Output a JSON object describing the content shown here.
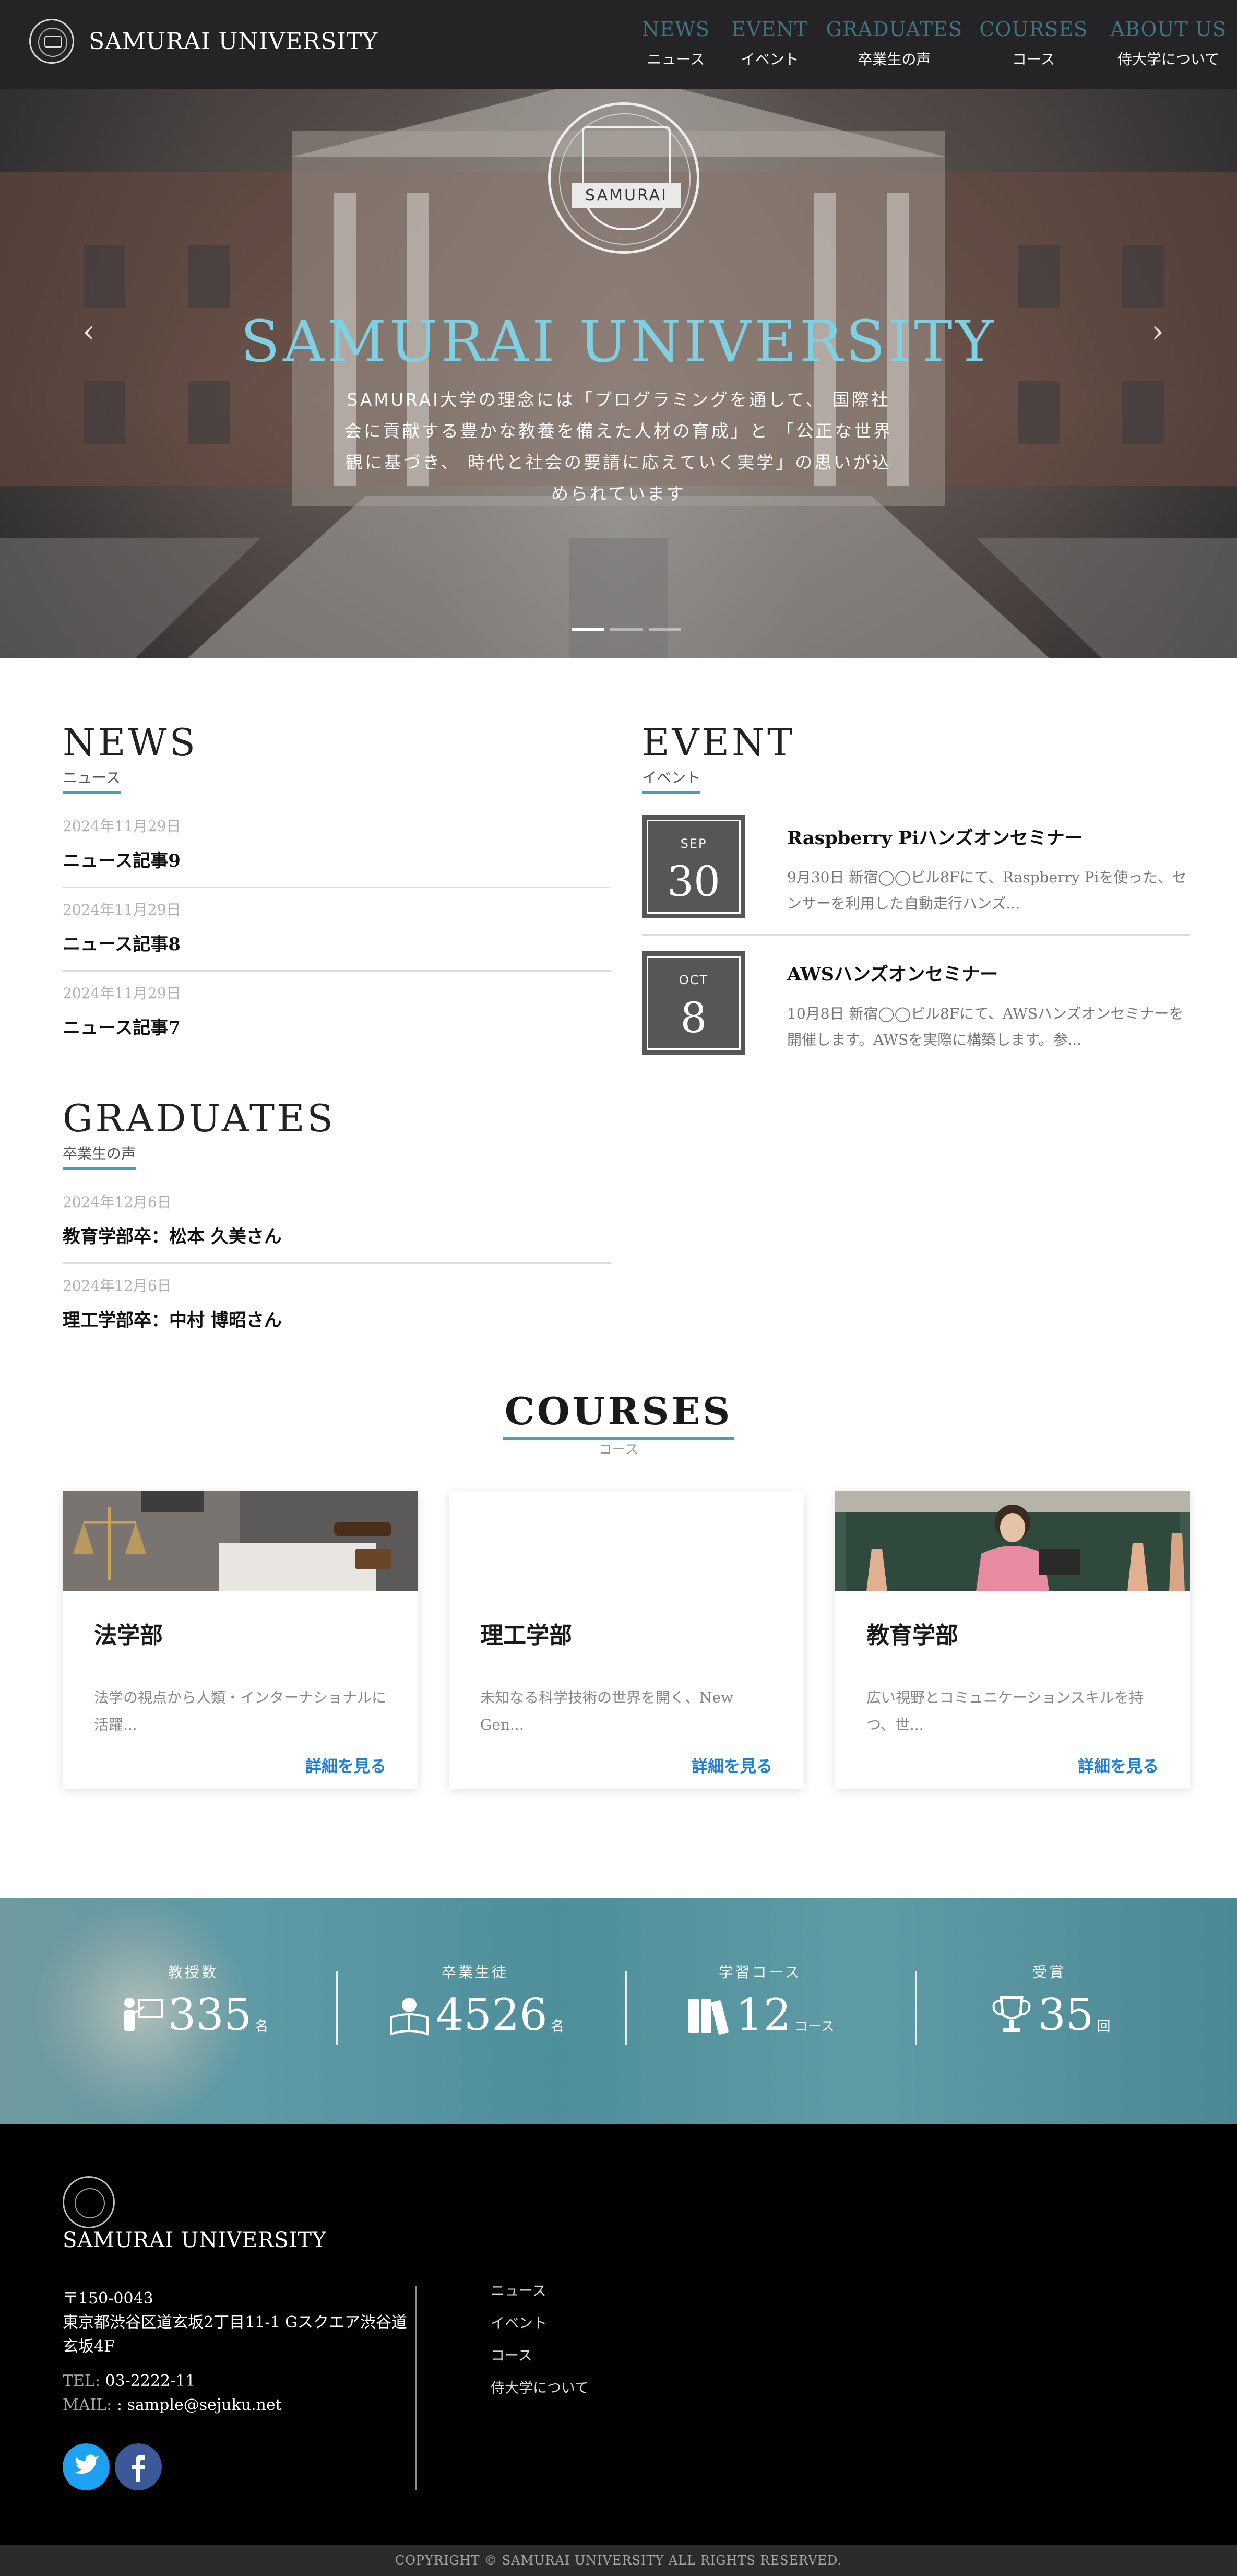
{
  "header": {
    "brand": "SAMURAI UNIVERSITY",
    "nav": [
      {
        "en": "NEWS",
        "jp": "ニュース"
      },
      {
        "en": "EVENT",
        "jp": "イベント"
      },
      {
        "en": "GRADUATES",
        "jp": "卒業生の声"
      },
      {
        "en": "COURSES",
        "jp": "コース"
      },
      {
        "en": "ABOUT US",
        "jp": "侍大学について"
      }
    ]
  },
  "hero": {
    "emblem_text": "SAMURAI",
    "title": "SAMURAI UNIVERSITY",
    "text": "SAMURAI大学の理念には「プログラミングを通して、 国際社会に貢献する豊かな教養を備えた人材の育成」と 「公正な世界観に基づき、 時代と社会の要請に応えていく実学」の思いが込められています",
    "prev_icon": "chevron-left-icon",
    "next_icon": "chevron-right-icon"
  },
  "news": {
    "title": "NEWS",
    "subtitle": "ニュース",
    "items": [
      {
        "date": "2024年11月29日",
        "title": "ニュース記事9"
      },
      {
        "date": "2024年11月29日",
        "title": "ニュース記事8"
      },
      {
        "date": "2024年11月29日",
        "title": "ニュース記事7"
      }
    ]
  },
  "event": {
    "title": "EVENT",
    "subtitle": "イベント",
    "items": [
      {
        "month": "SEP",
        "day": "30",
        "title": "Raspberry Piハンズオンセミナー",
        "desc": "9月30日 新宿◯◯ビル8Fにて、Raspberry Piを使った、センサーを利用した自動走行ハンズ..."
      },
      {
        "month": "OCT",
        "day": "8",
        "title": "AWSハンズオンセミナー",
        "desc": "10月8日 新宿◯◯ビル8Fにて、AWSハンズオンセミナーを開催します。AWSを実際に構築します。参..."
      }
    ]
  },
  "graduates": {
    "title": "GRADUATES",
    "subtitle": "卒業生の声",
    "items": [
      {
        "date": "2024年12月6日",
        "title": "教育学部卒：松本 久美さん"
      },
      {
        "date": "2024年12月6日",
        "title": "理工学部卒：中村 博昭さん"
      }
    ]
  },
  "courses": {
    "title": "COURSES",
    "subtitle": "コース",
    "cards": [
      {
        "title": "法学部",
        "desc": "法学の視点から人類・インターナショナルに活躍...",
        "link": "詳細を見る"
      },
      {
        "title": "理工学部",
        "desc": "未知なる科学技術の世界を開く、New Gen...",
        "link": "詳細を見る"
      },
      {
        "title": "教育学部",
        "desc": "広い視野とコミュニケーションスキルを持つ、世...",
        "link": "詳細を見る"
      }
    ]
  },
  "stats": [
    {
      "label": "教授数",
      "value": "335",
      "unit": "名",
      "icon": "teacher-icon"
    },
    {
      "label": "卒業生徒",
      "value": "4526",
      "unit": "名",
      "icon": "graduate-reading-icon"
    },
    {
      "label": "学習コース",
      "value": "12",
      "unit": "コース",
      "icon": "books-icon"
    },
    {
      "label": "受賞",
      "value": "35",
      "unit": "回",
      "icon": "trophy-icon"
    }
  ],
  "footer": {
    "brand": "SAMURAI UNIVERSITY",
    "postal": "〒150-0043",
    "address": "東京都渋谷区道玄坂2丁目11-1 Gスクエア渋谷道玄坂4F",
    "tel_label": "TEL:",
    "tel": "03-2222-11",
    "mail_label": "MAIL:",
    "mail": ": sample@sejuku.net",
    "links": [
      "ニュース",
      "イベント",
      "コース",
      "侍大学について"
    ],
    "copyright": "COPYRIGHT © SAMURAI UNIVERSITY ALL RIGHTS RESERVED."
  },
  "colors": {
    "accent": "#4b9fb1",
    "hero_title": "#7fd0e2",
    "link": "#1a7fd6",
    "twitter": "#1da1f2",
    "facebook": "#3b5998"
  }
}
